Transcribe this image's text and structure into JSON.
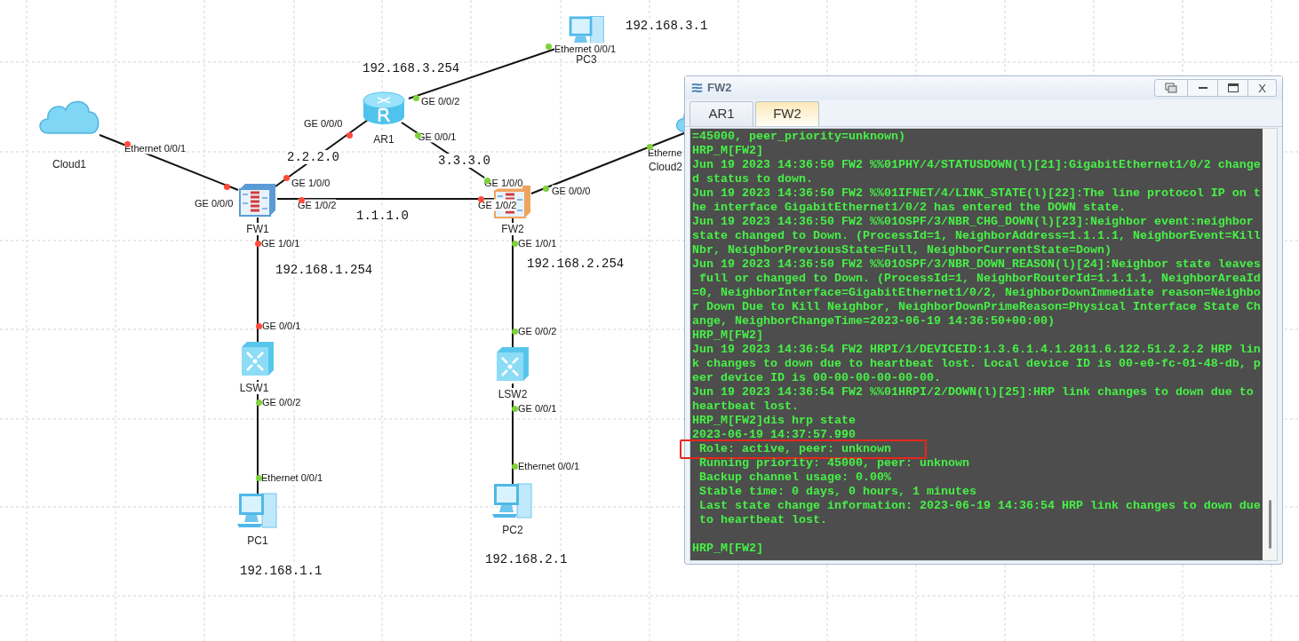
{
  "canvas": {
    "nodes": [
      {
        "kind": "cloud",
        "label": "Cloud1"
      },
      {
        "kind": "router",
        "label": "AR1"
      },
      {
        "kind": "pc",
        "label": "PC3"
      },
      {
        "kind": "firewall",
        "label": "FW1",
        "color": "#5b9bd5"
      },
      {
        "kind": "firewall",
        "label": "FW2",
        "color": "#f0a35e"
      },
      {
        "kind": "cloud",
        "label": "Cloud2"
      },
      {
        "kind": "switch",
        "label": "LSW1"
      },
      {
        "kind": "switch",
        "label": "LSW2"
      },
      {
        "kind": "pc",
        "label": "PC1"
      },
      {
        "kind": "pc",
        "label": "PC2"
      }
    ],
    "ports": [
      {
        "label": "Ethernet 0/0/1",
        "color": "#ff4b3a"
      },
      {
        "label": "GE 0/0/0",
        "color": "#ff4b3a"
      },
      {
        "label": "GE 1/0/0",
        "color": "#ff4b3a"
      },
      {
        "label": "GE 1/0/2",
        "color": "#ff4b3a"
      },
      {
        "label": "GE 1/0/1",
        "color": "#ff4b3a"
      },
      {
        "label": "GE 0/0/0",
        "color": "#ff4b3a"
      },
      {
        "label": "GE 0/0/2",
        "color": "#7ed23a"
      },
      {
        "label": "GE 0/0/1",
        "color": "#7ed23a"
      },
      {
        "label": "GE 1/0/0",
        "color": "#7ed23a"
      },
      {
        "label": "GE 1/0/2",
        "color": "#ff4b3a"
      },
      {
        "label": "GE 0/0/0",
        "color": "#7ed23a"
      },
      {
        "label": "GE 1/0/1",
        "color": "#7ed23a"
      },
      {
        "label": "Ethernet 0/0/1",
        "color": "#7ed23a"
      },
      {
        "label": "Etherne",
        "color": "#7ed23a"
      },
      {
        "label": "GE 0/0/1",
        "color": "#ff4b3a"
      },
      {
        "label": "GE 0/0/2",
        "color": "#7ed23a"
      },
      {
        "label": "Ethernet 0/0/1",
        "color": "#7ed23a"
      },
      {
        "label": "GE 0/0/2",
        "color": "#7ed23a"
      },
      {
        "label": "GE 0/0/1",
        "color": "#7ed23a"
      },
      {
        "label": "Ethernet 0/0/1",
        "color": "#7ed23a"
      }
    ],
    "annotations": [
      "192.168.3.1",
      "192.168.3.254",
      "2.2.2.0",
      "3.3.3.0",
      "1.1.1.0",
      "192.168.1.254",
      "192.168.2.254",
      "192.168.1.1",
      "192.168.2.1"
    ]
  },
  "console_window": {
    "title": "FW2",
    "close": "X",
    "tabs": [
      {
        "label": "AR1",
        "selected": false
      },
      {
        "label": "FW2",
        "selected": true
      }
    ],
    "lines": [
      {
        "text": "=45000, peer_priority=unknown)",
        "highlighted": false
      },
      {
        "text": "HRP_M[FW2]",
        "highlighted": false
      },
      {
        "text": "Jun 19 2023 14:36:50 FW2 %%01PHY/4/STATUSDOWN(l)[21]:GigabitEthernet1/0/2 change",
        "highlighted": false
      },
      {
        "text": "d status to down.",
        "highlighted": false
      },
      {
        "text": "Jun 19 2023 14:36:50 FW2 %%01IFNET/4/LINK_STATE(l)[22]:The line protocol IP on t",
        "highlighted": false
      },
      {
        "text": "he interface GigabitEthernet1/0/2 has entered the DOWN state.",
        "highlighted": false
      },
      {
        "text": "Jun 19 2023 14:36:50 FW2 %%01OSPF/3/NBR_CHG_DOWN(l)[23]:Neighbor event:neighbor",
        "highlighted": false
      },
      {
        "text": "state changed to Down. (ProcessId=1, NeighborAddress=1.1.1.1, NeighborEvent=Kill",
        "highlighted": false
      },
      {
        "text": "Nbr, NeighborPreviousState=Full, NeighborCurrentState=Down)",
        "highlighted": false
      },
      {
        "text": "Jun 19 2023 14:36:50 FW2 %%01OSPF/3/NBR_DOWN_REASON(l)[24]:Neighbor state leaves",
        "highlighted": false
      },
      {
        "text": " full or changed to Down. (ProcessId=1, NeighborRouterId=1.1.1.1, NeighborAreaId",
        "highlighted": false
      },
      {
        "text": "=0, NeighborInterface=GigabitEthernet1/0/2, NeighborDownImmediate reason=Neighbo",
        "highlighted": false
      },
      {
        "text": "r Down Due to Kill Neighbor, NeighborDownPrimeReason=Physical Interface State Ch",
        "highlighted": false
      },
      {
        "text": "ange, NeighborChangeTime=2023-06-19 14:36:50+00:00)",
        "highlighted": false
      },
      {
        "text": "HRP_M[FW2]",
        "highlighted": false
      },
      {
        "text": "Jun 19 2023 14:36:54 FW2 HRPI/1/DEVICEID:1.3.6.1.4.1.2011.6.122.51.2.2.2 HRP lin",
        "highlighted": false
      },
      {
        "text": "k changes to down due to heartbeat lost. Local device ID is 00-e0-fc-01-48-db, p",
        "highlighted": false
      },
      {
        "text": "eer device ID is 00-00-00-00-00-00.",
        "highlighted": false
      },
      {
        "text": "Jun 19 2023 14:36:54 FW2 %%01HRPI/2/DOWN(l)[25]:HRP link changes to down due to",
        "highlighted": false
      },
      {
        "text": "heartbeat lost.",
        "highlighted": false
      },
      {
        "text": "HRP_M[FW2]dis hrp state",
        "highlighted": false
      },
      {
        "text": "2023-06-19 14:37:57.990",
        "highlighted": false
      },
      {
        "text": " Role: active, peer: unknown",
        "highlighted": true
      },
      {
        "text": " Running priority: 45000, peer: unknown",
        "highlighted": false
      },
      {
        "text": " Backup channel usage: 0.00%",
        "highlighted": false
      },
      {
        "text": " Stable time: 0 days, 0 hours, 1 minutes",
        "highlighted": false
      },
      {
        "text": " Last state change information: 2023-06-19 14:36:54 HRP link changes to down due",
        "highlighted": false
      },
      {
        "text": " to heartbeat lost.",
        "highlighted": false
      },
      {
        "text": "HRP_M[FW2]",
        "highlighted": false,
        "blank_before": true
      }
    ]
  }
}
